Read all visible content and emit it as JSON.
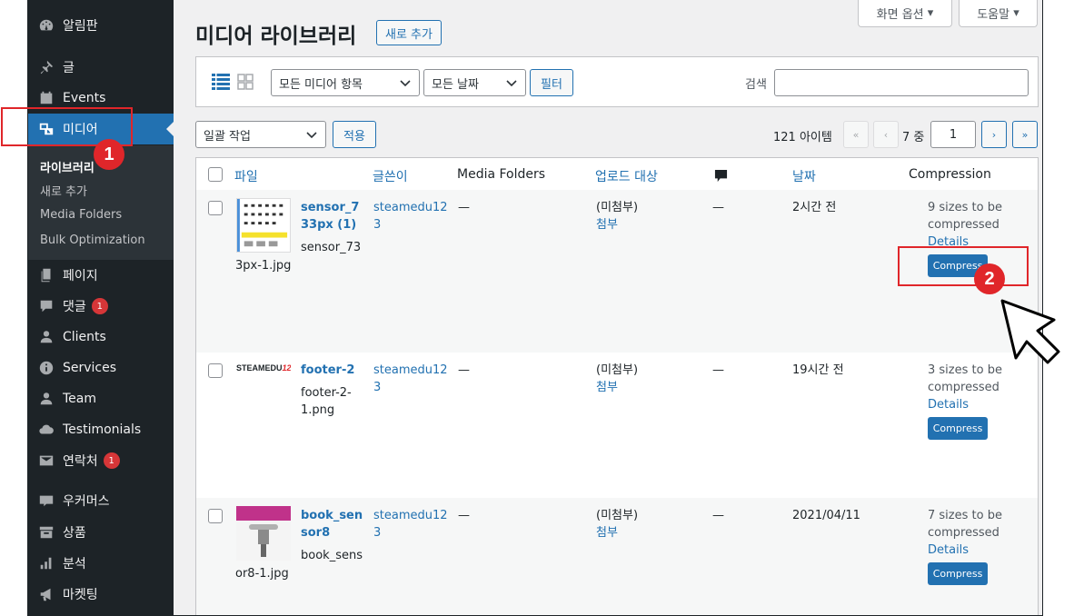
{
  "sidebar": {
    "items": [
      {
        "label": "알림판",
        "icon": "dashboard-icon"
      },
      {
        "label": "글",
        "icon": "pin-icon"
      },
      {
        "label": "Events",
        "icon": "calendar-icon"
      },
      {
        "label": "미디어",
        "icon": "media-icon"
      },
      {
        "label": "페이지",
        "icon": "page-icon"
      },
      {
        "label": "댓글",
        "icon": "comment-icon",
        "badge": "1"
      },
      {
        "label": "Clients",
        "icon": "user-icon"
      },
      {
        "label": "Services",
        "icon": "info-icon"
      },
      {
        "label": "Team",
        "icon": "user-icon"
      },
      {
        "label": "Testimonials",
        "icon": "cloud-icon"
      },
      {
        "label": "연락처",
        "icon": "mail-icon",
        "badge": "1"
      },
      {
        "label": "우커머스",
        "icon": "woo-icon"
      },
      {
        "label": "상품",
        "icon": "archive-icon"
      },
      {
        "label": "분석",
        "icon": "chart-icon"
      },
      {
        "label": "마켓팅",
        "icon": "megaphone-icon"
      }
    ],
    "submenu": [
      "라이브러리",
      "새로 추가",
      "Media Folders",
      "Bulk Optimization"
    ]
  },
  "header": {
    "title": "미디어 라이브러리",
    "add_new": "새로 추가",
    "screen_options": "화면 옵션",
    "help": "도움말"
  },
  "filters": {
    "media_type": "모든 미디어 항목",
    "date": "모든 날짜",
    "filter_button": "필터",
    "search_label": "검색"
  },
  "bulk": {
    "action": "일괄 작업",
    "apply": "적용"
  },
  "pagination": {
    "count": "121 아이템",
    "first": "«",
    "prev": "‹",
    "total": "7 중",
    "current": "1",
    "next": "›",
    "last": "»"
  },
  "table": {
    "columns": [
      "파일",
      "글쓴이",
      "Media Folders",
      "업로드 대상",
      "날짜",
      "Compression"
    ],
    "rows": [
      {
        "title_line1": "sensor_7",
        "title_line2": "33px (1)",
        "filename_line1": "sensor_73",
        "filename_line2": "3px-1.jpg",
        "author_line1": "steamedu12",
        "author_line2": "3",
        "folder": "—",
        "uploaded_to": "(미첨부)",
        "attach": "첨부",
        "comments": "—",
        "date": "2시간 전",
        "compression_line1": "9 sizes to be",
        "compression_line2": "compressed",
        "details": "Details",
        "compress": "Compress"
      },
      {
        "title_line1": "footer-2",
        "title_line2": "",
        "filename_line1": "footer-2-",
        "filename_line2": "1.png",
        "thumb_text": "STEAMEDU",
        "thumb_text_accent": "12",
        "author_line1": "steamedu12",
        "author_line2": "3",
        "folder": "—",
        "uploaded_to": "(미첨부)",
        "attach": "첨부",
        "comments": "—",
        "date": "19시간 전",
        "compression_line1": "3 sizes to be",
        "compression_line2": "compressed",
        "details": "Details",
        "compress": "Compress"
      },
      {
        "title_line1": "book_sen",
        "title_line2": "sor8",
        "filename_line1": "book_sens",
        "filename_line2": "or8-1.jpg",
        "author_line1": "steamedu12",
        "author_line2": "3",
        "folder": "—",
        "uploaded_to": "(미첨부)",
        "attach": "첨부",
        "comments": "—",
        "date": "2021/04/11",
        "compression_line1": "7 sizes to be",
        "compression_line2": "compressed",
        "details": "Details",
        "compress": "Compress"
      }
    ]
  },
  "annotations": {
    "step1": "1",
    "step2": "2"
  },
  "colors": {
    "sidebar": "#1d2327",
    "accent": "#2271b1",
    "annotation": "#e0262a"
  }
}
